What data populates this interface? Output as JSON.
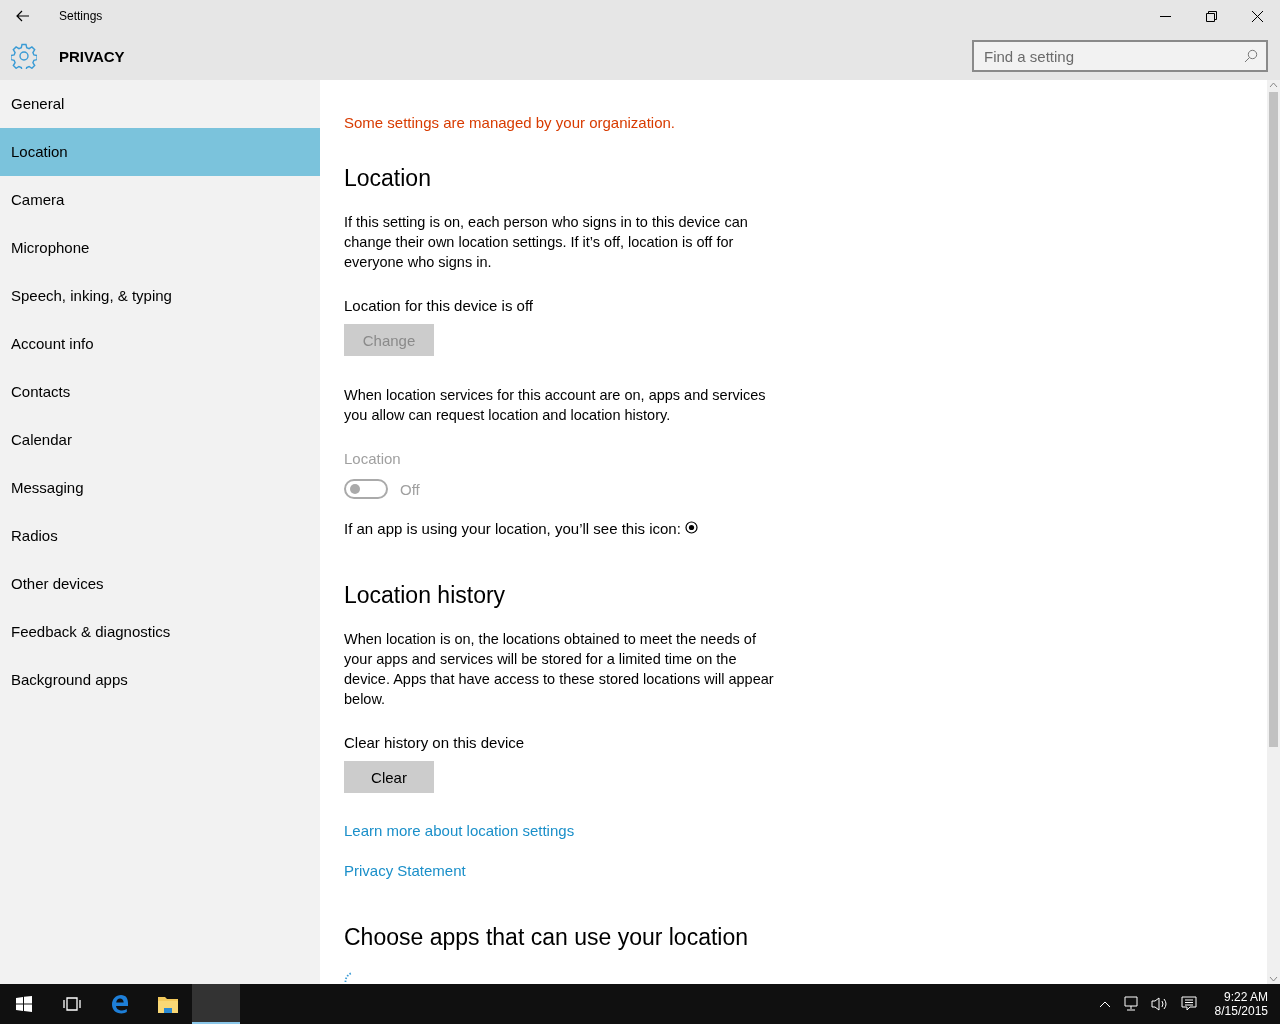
{
  "window": {
    "title": "Settings"
  },
  "header": {
    "title": "PRIVACY"
  },
  "search": {
    "placeholder": "Find a setting"
  },
  "sidebar": {
    "items": [
      {
        "label": "General",
        "selected": false
      },
      {
        "label": "Location",
        "selected": true
      },
      {
        "label": "Camera",
        "selected": false
      },
      {
        "label": "Microphone",
        "selected": false
      },
      {
        "label": "Speech, inking, & typing",
        "selected": false
      },
      {
        "label": "Account info",
        "selected": false
      },
      {
        "label": "Contacts",
        "selected": false
      },
      {
        "label": "Calendar",
        "selected": false
      },
      {
        "label": "Messaging",
        "selected": false
      },
      {
        "label": "Radios",
        "selected": false
      },
      {
        "label": "Other devices",
        "selected": false
      },
      {
        "label": "Feedback & diagnostics",
        "selected": false
      },
      {
        "label": "Background apps",
        "selected": false
      }
    ]
  },
  "content": [
    {
      "kind": "notice",
      "text": "Some settings are managed by your organization."
    },
    {
      "kind": "heading",
      "text": "Location"
    },
    {
      "kind": "paragraph",
      "text": "If this setting is on, each person who signs in to this device can change their own location settings. If it’s off, location is off for everyone who signs in."
    },
    {
      "kind": "label",
      "text": "Location for this device is off"
    },
    {
      "kind": "button",
      "text": "Change",
      "disabled": true
    },
    {
      "kind": "paragraph",
      "text": "When location services for this account are on, apps and services you allow can request location and location history."
    },
    {
      "kind": "toggle",
      "text": "Location",
      "on": false,
      "disabled": true,
      "state_text": "Off"
    },
    {
      "kind": "icon-line",
      "text": "If an app is using your location, you’ll see this icon:"
    },
    {
      "kind": "heading",
      "text": "Location history"
    },
    {
      "kind": "paragraph",
      "text": "When location is on, the locations obtained to meet the needs of your apps and services will be stored for a limited time on the device. Apps that have access to these stored locations will appear below."
    },
    {
      "kind": "label",
      "text": "Clear history on this device"
    },
    {
      "kind": "button",
      "text": "Clear",
      "disabled": false
    },
    {
      "kind": "link",
      "text": "Learn more about location settings"
    },
    {
      "kind": "link",
      "text": "Privacy Statement"
    },
    {
      "kind": "heading",
      "text": "Choose apps that can use your location"
    },
    {
      "kind": "spinner"
    }
  ],
  "taskbar": {
    "clock": {
      "time": "9:22 AM",
      "date": "8/15/2015"
    }
  }
}
